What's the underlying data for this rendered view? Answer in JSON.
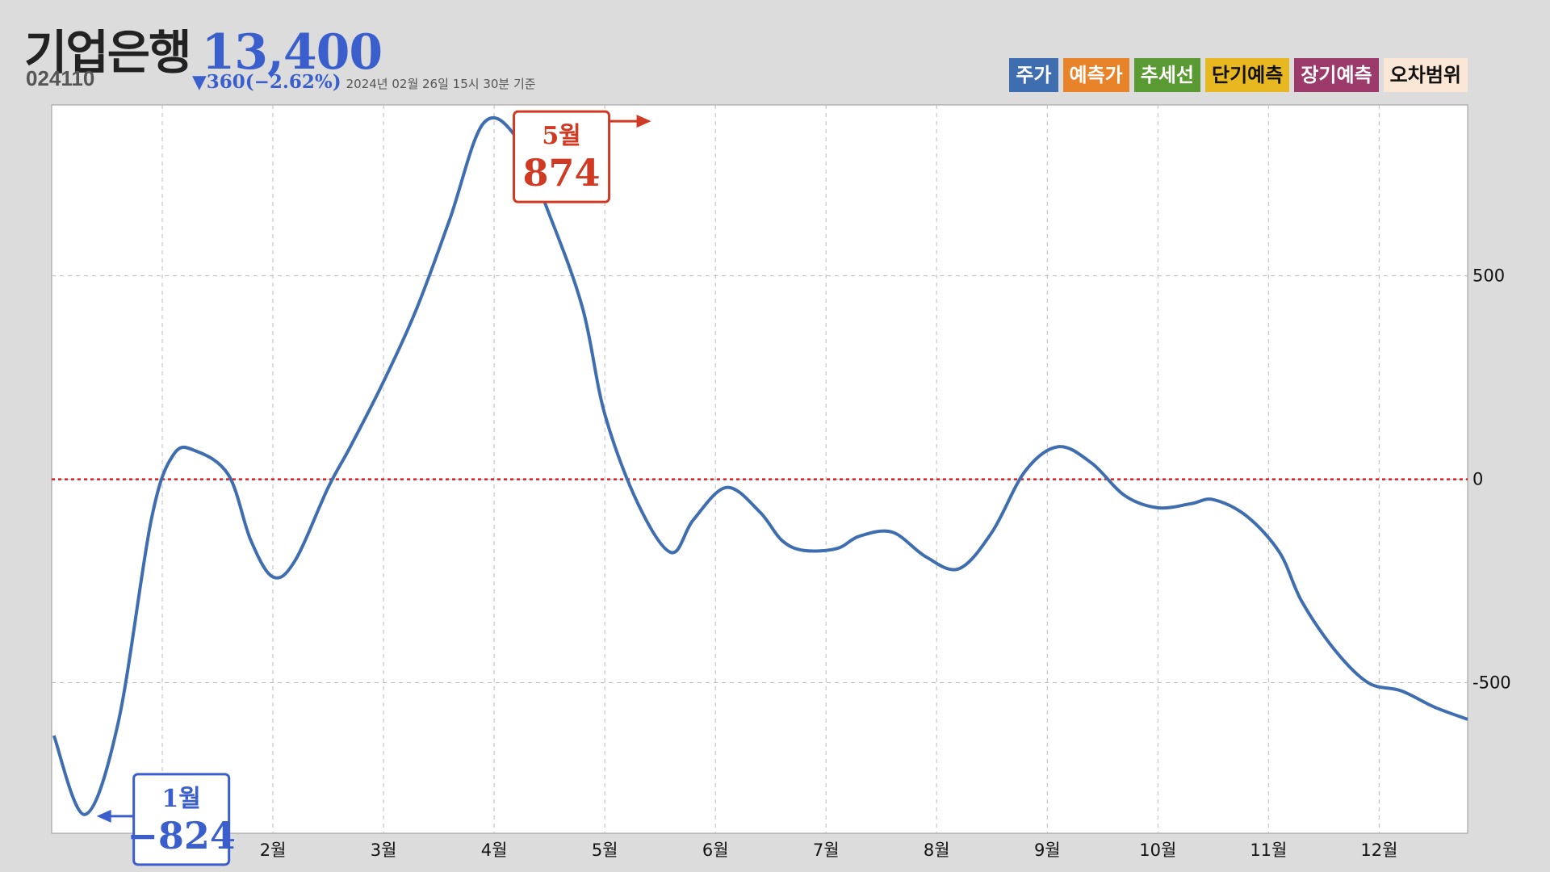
{
  "header": {
    "name": "기업은행",
    "price": "13,400",
    "code": "024110",
    "change": "▼360(−2.62%)",
    "timestamp": "2024년 02월 26일 15시 30분 기준"
  },
  "legend": [
    {
      "label": "주가",
      "bg": "#3e6db0",
      "fg": "#ffffff"
    },
    {
      "label": "예측가",
      "bg": "#e8832a",
      "fg": "#ffffff"
    },
    {
      "label": "추세선",
      "bg": "#5a9a32",
      "fg": "#ffffff"
    },
    {
      "label": "단기예측",
      "bg": "#e8b820",
      "fg": "#111111"
    },
    {
      "label": "장기예측",
      "bg": "#9b3a6b",
      "fg": "#ffffff"
    },
    {
      "label": "오차범위",
      "bg": "#fbe7d6",
      "fg": "#111111"
    }
  ],
  "colors": {
    "line": "#3e6db0",
    "zero_line": "#d62020",
    "max_callout": "#d03a22",
    "min_callout": "#3a5fcd"
  },
  "chart_data": {
    "type": "line",
    "xlim": [
      0,
      12.8
    ],
    "ylim": [
      -870,
      920
    ],
    "x_ticks": [
      1,
      2,
      3,
      4,
      5,
      6,
      7,
      8,
      9,
      10,
      11,
      12
    ],
    "x_tick_labels": [
      "1월",
      "2월",
      "3월",
      "4월",
      "5월",
      "6월",
      "7월",
      "8월",
      "9월",
      "10월",
      "11월",
      "12월"
    ],
    "y_ticks": [
      500,
      0,
      -500
    ],
    "y_tick_labels": [
      "500",
      "0",
      "-500"
    ],
    "grid": true,
    "zero_line": 0,
    "series": [
      {
        "x": [
          0.02,
          0.3,
          0.6,
          0.9,
          1.1,
          1.3,
          1.6,
          1.8,
          2.0,
          2.2,
          2.5,
          2.7,
          3.0,
          3.3,
          3.6,
          3.9,
          4.2,
          4.5,
          4.8,
          5.0,
          5.3,
          5.6,
          5.8,
          6.1,
          6.4,
          6.6,
          6.8,
          7.1,
          7.3,
          7.6,
          7.9,
          8.2,
          8.5,
          8.8,
          9.1,
          9.4,
          9.7,
          10.0,
          10.3,
          10.5,
          10.8,
          11.1,
          11.3,
          11.6,
          11.9,
          12.2,
          12.5,
          12.8
        ],
        "y": [
          -630,
          -824,
          -600,
          -100,
          60,
          70,
          10,
          -150,
          -240,
          -200,
          -20,
          80,
          240,
          420,
          640,
          874,
          840,
          650,
          420,
          160,
          -60,
          -180,
          -100,
          -20,
          -80,
          -150,
          -175,
          -170,
          -140,
          -130,
          -190,
          -220,
          -130,
          20,
          80,
          40,
          -40,
          -70,
          -60,
          -50,
          -90,
          -180,
          -300,
          -420,
          -500,
          -520,
          -560,
          -590
        ]
      }
    ],
    "annotations": [
      {
        "type": "max",
        "month": "5월",
        "value": "874",
        "x": 5.2,
        "y": 874
      },
      {
        "type": "min",
        "month": "1월",
        "value": "-824",
        "x": 0.45,
        "y": -824
      }
    ]
  }
}
